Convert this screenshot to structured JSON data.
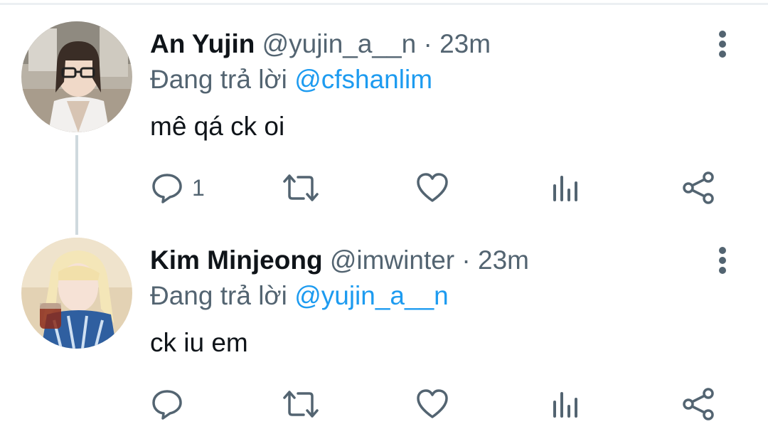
{
  "tweets": [
    {
      "display_name": "An Yujin",
      "handle": "@yujin_a__n",
      "separator": "·",
      "time": "23m",
      "reply_prefix": "Đang trả lời",
      "reply_to": "@cfshanlim",
      "text": "mê qá ck oi",
      "reply_count": "1",
      "avatar": "profile-photo"
    },
    {
      "display_name": "Kim Minjeong",
      "handle": "@imwinter",
      "separator": "·",
      "time": "23m",
      "reply_prefix": "Đang trả lời",
      "reply_to": "@yujin_a__n",
      "text": "ck iu em",
      "reply_count": "",
      "avatar": "profile-photo"
    }
  ],
  "icons": {
    "more": "more-vertical-icon",
    "reply": "reply-icon",
    "retweet": "retweet-icon",
    "like": "heart-icon",
    "views": "views-icon",
    "share": "share-icon"
  },
  "colors": {
    "text_primary": "#0f1419",
    "text_secondary": "#536471",
    "mention": "#1d9bf0",
    "icon": "#536471",
    "thread_line": "#cfd9de"
  }
}
